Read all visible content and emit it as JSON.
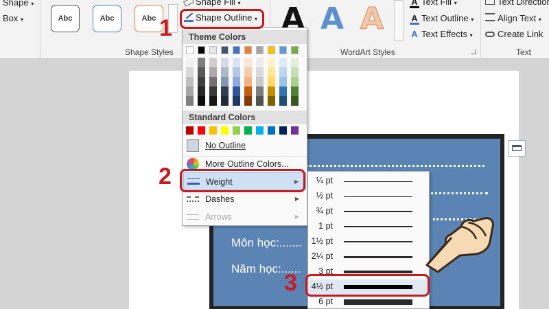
{
  "ribbon": {
    "left_items": [
      "Shape",
      "Box"
    ],
    "style_gallery": [
      "Abc",
      "Abc",
      "Abc"
    ],
    "shape_fill": "Shape Fill",
    "shape_outline": "Shape Outline",
    "group_shape_styles": "Shape Styles",
    "wordart_letters": [
      "A",
      "A",
      "A"
    ],
    "text_fill": "Text Fill",
    "text_outline": "Text Outline",
    "text_effects": "Text Effects",
    "group_wordart_styles": "WordArt Styles",
    "text_direction": "Text Direction",
    "align_text": "Align Text",
    "create_link": "Create Link",
    "group_text": "Text"
  },
  "dropdown": {
    "theme_colors_header": "Theme Colors",
    "standard_colors_header": "Standard Colors",
    "theme_columns": [
      [
        "#ffffff",
        "#f2f2f2",
        "#d9d9d9",
        "#bfbfbf",
        "#a6a6a6",
        "#7f7f7f"
      ],
      [
        "#000000",
        "#7f7f7f",
        "#595959",
        "#404040",
        "#262626",
        "#0d0d0d"
      ],
      [
        "#e7e6e6",
        "#d0cece",
        "#aeaaaa",
        "#757171",
        "#3a3838",
        "#171616"
      ],
      [
        "#44546a",
        "#d6dce5",
        "#adb9ca",
        "#8497b0",
        "#333f50",
        "#222a35"
      ],
      [
        "#4472c4",
        "#dae3f3",
        "#b4c7e7",
        "#8faadc",
        "#2f5597",
        "#1f3864"
      ],
      [
        "#ed7d31",
        "#fbe5d6",
        "#f8cbad",
        "#f4b183",
        "#c55a11",
        "#843c0c"
      ],
      [
        "#a5a5a5",
        "#ededed",
        "#dbdbdb",
        "#c9c9c9",
        "#7b7b7b",
        "#525252"
      ],
      [
        "#ffc000",
        "#fff2cc",
        "#ffe699",
        "#ffd966",
        "#bf9000",
        "#7f6000"
      ],
      [
        "#5b9bd5",
        "#deebf7",
        "#bdd7ee",
        "#9dc3e6",
        "#2e75b6",
        "#1f4e79"
      ],
      [
        "#70ad47",
        "#e2f0d9",
        "#c5e0b4",
        "#a9d18e",
        "#548235",
        "#385723"
      ]
    ],
    "standard_colors": [
      "#c00000",
      "#ff0000",
      "#ffc000",
      "#ffff00",
      "#92d050",
      "#00b050",
      "#00b0f0",
      "#0070c0",
      "#002060",
      "#7030a0"
    ],
    "no_outline": "No Outline",
    "more_outline_colors": "More Outline Colors...",
    "weight": "Weight",
    "dashes": "Dashes",
    "arrows": "Arrows"
  },
  "weight_submenu": [
    {
      "label": "¼ pt"
    },
    {
      "label": "½ pt"
    },
    {
      "label": "¾ pt"
    },
    {
      "label": "1 pt"
    },
    {
      "label": "1½ pt"
    },
    {
      "label": "2¼ pt"
    },
    {
      "label": "3 pt"
    },
    {
      "label": "4½ pt"
    },
    {
      "label": "6 pt"
    }
  ],
  "slide": {
    "line1": "Môn học:.......",
    "line2": "Năm học:......"
  },
  "annotations": {
    "step1": "1",
    "step2": "2",
    "step3": "3",
    "accent": "#c8191e"
  }
}
